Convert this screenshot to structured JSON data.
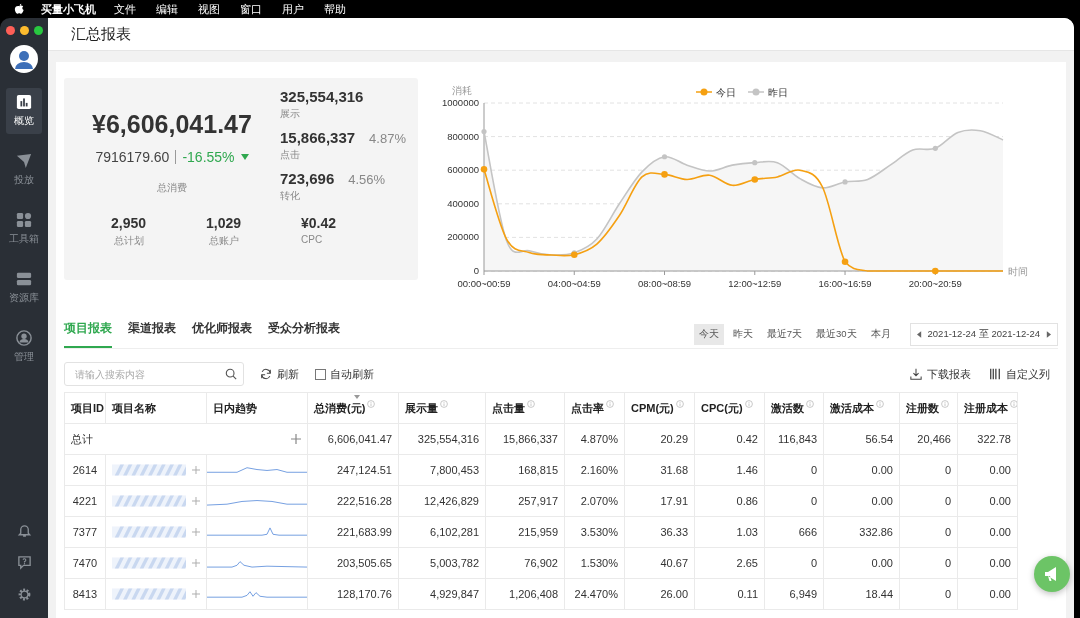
{
  "menu_bar": {
    "app": "买量小飞机",
    "items": [
      "文件",
      "编辑",
      "视图",
      "窗口",
      "用户",
      "帮助"
    ]
  },
  "window": {
    "title": "汇总报表"
  },
  "sidebar": {
    "items": [
      {
        "label": "概览",
        "selected": true
      },
      {
        "label": "投放",
        "selected": false
      },
      {
        "label": "工具箱",
        "selected": false
      },
      {
        "label": "资源库",
        "selected": false
      },
      {
        "label": "管理",
        "selected": false
      }
    ]
  },
  "summary": {
    "total": {
      "value": "¥6,606,041.47",
      "compare": "7916179.60",
      "change": "-16.55%",
      "label": "总消费"
    },
    "metrics": [
      {
        "value": "325,554,316",
        "label": "展示"
      },
      {
        "value": "15,866,337",
        "rate": "4.87%",
        "label": "点击"
      },
      {
        "value": "723,696",
        "rate": "4.56%",
        "label": "转化"
      }
    ],
    "sub_metrics": [
      {
        "value": "2,950",
        "label": "总计划"
      },
      {
        "value": "1,029",
        "label": "总账户"
      },
      {
        "value": "¥0.42",
        "label": "CPC"
      }
    ]
  },
  "chart_data": {
    "type": "line",
    "xlabel": "时间",
    "ylabel": "消耗",
    "categories": [
      "00:00~00:59",
      null,
      null,
      null,
      "04:00~04:59",
      null,
      null,
      null,
      "08:00~08:59",
      null,
      null,
      null,
      "12:00~12:59",
      null,
      null,
      null,
      "16:00~16:59",
      null,
      null,
      null,
      "20:00~20:59",
      null,
      null,
      null
    ],
    "yticks": [
      0,
      200000,
      400000,
      600000,
      800000,
      1000000
    ],
    "ylim": [
      0,
      1000000
    ],
    "grid": true,
    "legend": true,
    "series": [
      {
        "name": "今日",
        "color": "#f5a012",
        "values": [
          605000,
          190000,
          110000,
          95000,
          97000,
          160000,
          330000,
          560000,
          575000,
          545000,
          570000,
          510000,
          545000,
          560000,
          600000,
          500000,
          55000,
          0,
          0,
          0,
          0,
          0,
          0,
          0
        ]
      },
      {
        "name": "昨日",
        "color": "#c4c4c4",
        "type": "area",
        "values": [
          830000,
          180000,
          120000,
          95000,
          108000,
          190000,
          400000,
          590000,
          680000,
          630000,
          595000,
          630000,
          645000,
          645000,
          550000,
          495000,
          530000,
          545000,
          630000,
          720000,
          730000,
          825000,
          835000,
          780000
        ]
      }
    ]
  },
  "report_tabs": [
    {
      "label": "项目报表",
      "selected": true
    },
    {
      "label": "渠道报表",
      "selected": false
    },
    {
      "label": "优化师报表",
      "selected": false
    },
    {
      "label": "受众分析报表",
      "selected": false
    }
  ],
  "date_filters": [
    {
      "label": "今天",
      "selected": true
    },
    {
      "label": "昨天",
      "selected": false
    },
    {
      "label": "最近7天",
      "selected": false
    },
    {
      "label": "最近30天",
      "selected": false
    },
    {
      "label": "本月",
      "selected": false
    }
  ],
  "date_range": "2021-12-24 至 2021-12-24",
  "toolbar": {
    "search": {
      "placeholder": "请输入搜索内容"
    },
    "refresh": "刷新",
    "auto_refresh": {
      "label": "自动刷新",
      "checked": false
    },
    "download": "下载报表",
    "customize": "自定义列"
  },
  "table": {
    "columns": [
      {
        "label": "项目ID",
        "kind": "plain"
      },
      {
        "label": "项目名称",
        "kind": "plain"
      },
      {
        "label": "日内趋势",
        "kind": "plain"
      },
      {
        "label": "总消费(元)",
        "kind": "sorted"
      },
      {
        "label": "展示量",
        "kind": "info"
      },
      {
        "label": "点击量",
        "kind": "info"
      },
      {
        "label": "点击率",
        "kind": "info"
      },
      {
        "label": "CPM(元)",
        "kind": "info"
      },
      {
        "label": "CPC(元)",
        "kind": "info"
      },
      {
        "label": "激活数",
        "kind": "info"
      },
      {
        "label": "激活成本",
        "kind": "info"
      },
      {
        "label": "注册数",
        "kind": "info"
      },
      {
        "label": "注册成本",
        "kind": "info"
      }
    ],
    "total": {
      "label": "总计",
      "values": [
        "6,606,041.47",
        "325,554,316",
        "15,866,337",
        "4.870%",
        "20.29",
        "0.42",
        "116,843",
        "56.54",
        "20,466",
        "322.78"
      ]
    },
    "rows": [
      {
        "id": "2614",
        "values": [
          "247,124.51",
          "7,800,453",
          "168,815",
          "2.160%",
          "31.68",
          "1.46",
          "0",
          "0.00",
          "0",
          "0.00"
        ]
      },
      {
        "id": "4221",
        "values": [
          "222,516.28",
          "12,426,829",
          "257,917",
          "2.070%",
          "17.91",
          "0.86",
          "0",
          "0.00",
          "0",
          "0.00"
        ]
      },
      {
        "id": "7377",
        "values": [
          "221,683.99",
          "6,102,281",
          "215,959",
          "3.530%",
          "36.33",
          "1.03",
          "666",
          "332.86",
          "0",
          "0.00"
        ]
      },
      {
        "id": "7470",
        "values": [
          "203,505.65",
          "5,003,782",
          "76,902",
          "1.530%",
          "40.67",
          "2.65",
          "0",
          "0.00",
          "0",
          "0.00"
        ]
      },
      {
        "id": "8413",
        "values": [
          "128,170.76",
          "4,929,847",
          "1,206,408",
          "24.470%",
          "26.00",
          "0.11",
          "6,949",
          "18.44",
          "0",
          "0.00"
        ]
      }
    ]
  }
}
